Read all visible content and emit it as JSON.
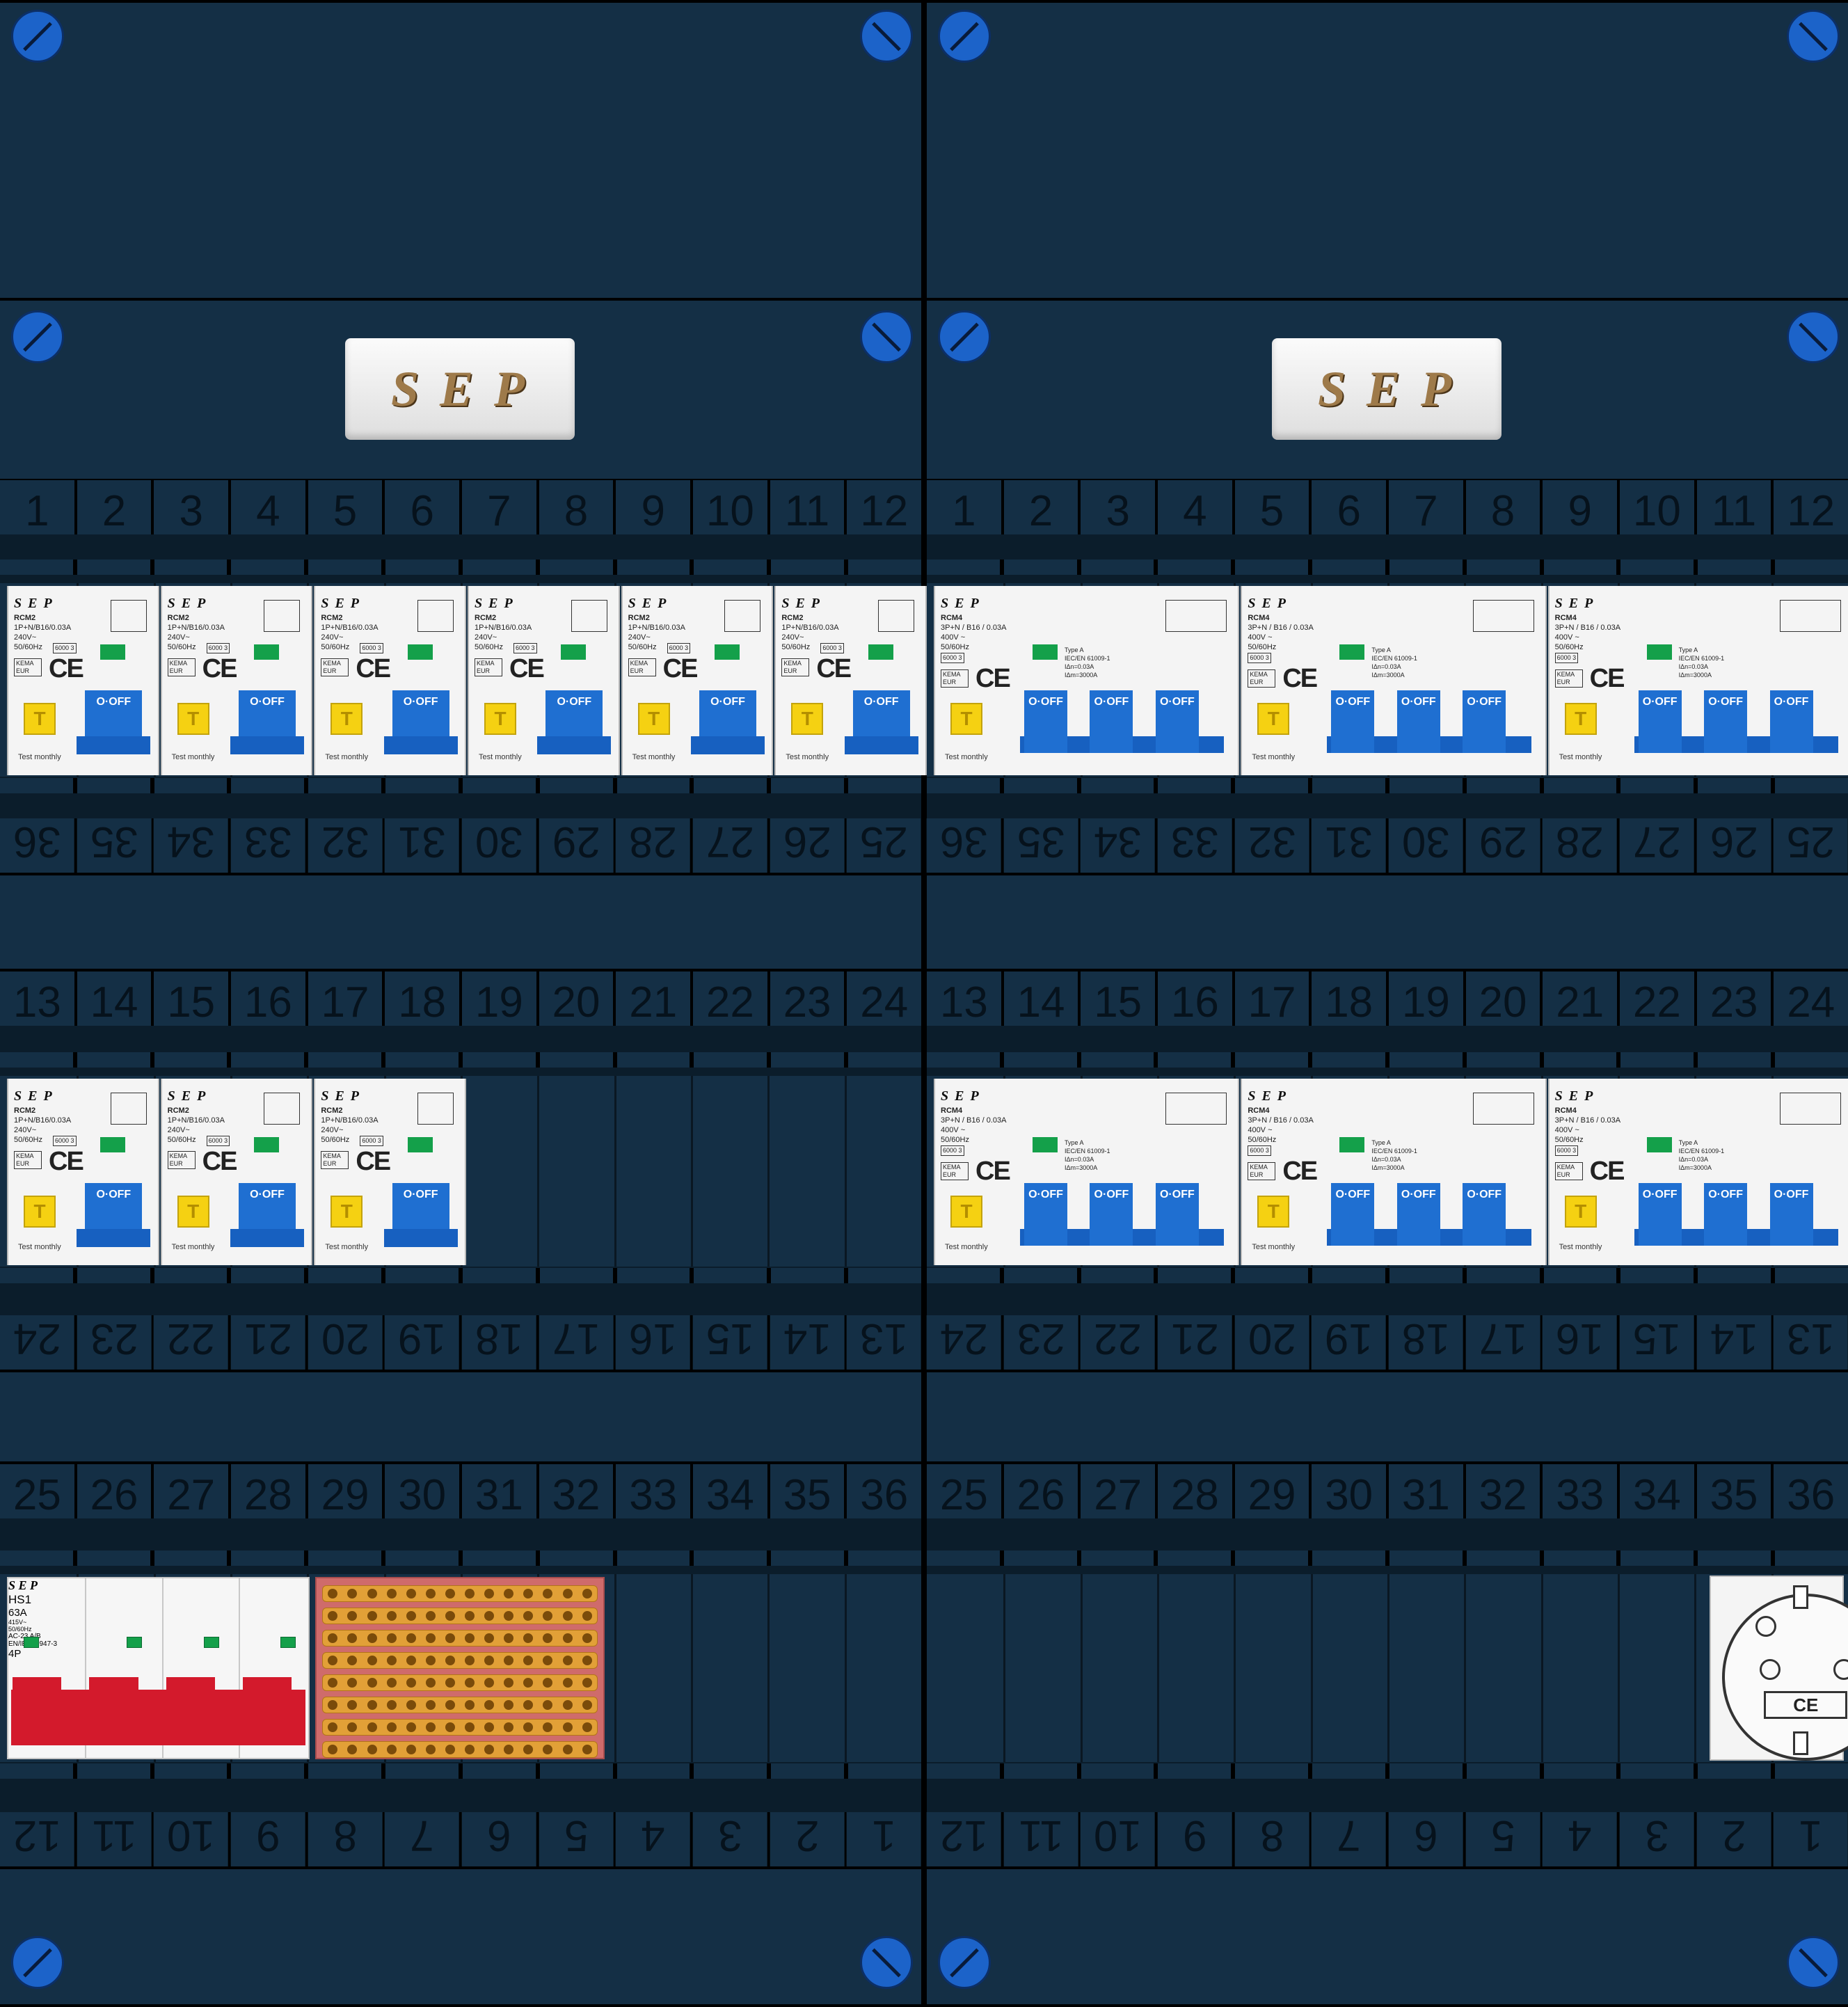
{
  "panels": [
    {
      "logo": "S E P",
      "rows": [
        {
          "top_numbers": [
            "1",
            "2",
            "3",
            "4",
            "5",
            "6",
            "7",
            "8",
            "9",
            "10",
            "11",
            "12"
          ],
          "bottom_numbers": [
            "36",
            "35",
            "34",
            "33",
            "32",
            "31",
            "30",
            "29",
            "28",
            "27",
            "26",
            "25"
          ],
          "devices": [
            {
              "model": "RCM2",
              "rating": "1P+N/B16/0.03A",
              "volt": "240V~",
              "freq": "50/60Hz",
              "code": "6000 3"
            },
            {
              "model": "RCM2",
              "rating": "1P+N/B16/0.03A",
              "volt": "240V~",
              "freq": "50/60Hz",
              "code": "6000 3"
            },
            {
              "model": "RCM2",
              "rating": "1P+N/B16/0.03A",
              "volt": "240V~",
              "freq": "50/60Hz",
              "code": "6000 3"
            },
            {
              "model": "RCM2",
              "rating": "1P+N/B16/0.03A",
              "volt": "240V~",
              "freq": "50/60Hz",
              "code": "6000 3"
            },
            {
              "model": "RCM2",
              "rating": "1P+N/B16/0.03A",
              "volt": "240V~",
              "freq": "50/60Hz",
              "code": "6000 3"
            },
            {
              "model": "RCM2",
              "rating": "1P+N/B16/0.03A",
              "volt": "240V~",
              "freq": "50/60Hz",
              "code": "6000 3"
            }
          ]
        },
        {
          "top_numbers": [
            "13",
            "14",
            "15",
            "16",
            "17",
            "18",
            "19",
            "20",
            "21",
            "22",
            "23",
            "24"
          ],
          "bottom_numbers": [
            "24",
            "23",
            "22",
            "21",
            "20",
            "19",
            "18",
            "17",
            "16",
            "15",
            "14",
            "13"
          ],
          "devices": [
            {
              "model": "RCM2",
              "rating": "1P+N/B16/0.03A",
              "volt": "240V~",
              "freq": "50/60Hz",
              "code": "6000 3"
            },
            {
              "model": "RCM2",
              "rating": "1P+N/B16/0.03A",
              "volt": "240V~",
              "freq": "50/60Hz",
              "code": "6000 3"
            },
            {
              "model": "RCM2",
              "rating": "1P+N/B16/0.03A",
              "volt": "240V~",
              "freq": "50/60Hz",
              "code": "6000 3"
            }
          ]
        },
        {
          "top_numbers": [
            "25",
            "26",
            "27",
            "28",
            "29",
            "30",
            "31",
            "32",
            "33",
            "34",
            "35",
            "36"
          ],
          "bottom_numbers": [
            "12",
            "11",
            "10",
            "9",
            "8",
            "7",
            "6",
            "5",
            "4",
            "3",
            "2",
            "1"
          ]
        }
      ],
      "main_switch": {
        "brand": "S E P",
        "name": "HS1",
        "rating": "63A",
        "volt": "415V~",
        "freq": "50/60Hz",
        "type": "AC-23 A/B",
        "standard": "EN/IEC60947-3",
        "poles": "4P"
      }
    },
    {
      "logo": "S E P",
      "rows": [
        {
          "top_numbers": [
            "1",
            "2",
            "3",
            "4",
            "5",
            "6",
            "7",
            "8",
            "9",
            "10",
            "11",
            "12"
          ],
          "bottom_numbers": [
            "36",
            "35",
            "34",
            "33",
            "32",
            "31",
            "30",
            "29",
            "28",
            "27",
            "26",
            "25"
          ],
          "devices": [
            {
              "model": "RCM4",
              "rating": "3P+N / B16 / 0.03A",
              "volt": "400V ~",
              "freq": "50/60Hz",
              "code": "6000 3",
              "typ": "Type A",
              "std": "IEC/EN 61009-1",
              "idn": "IΔn=0.03A",
              "idm": "IΔm=3000A"
            },
            {
              "model": "RCM4",
              "rating": "3P+N / B16 / 0.03A",
              "volt": "400V ~",
              "freq": "50/60Hz",
              "code": "6000 3",
              "typ": "Type A",
              "std": "IEC/EN 61009-1",
              "idn": "IΔn=0.03A",
              "idm": "IΔm=3000A"
            },
            {
              "model": "RCM4",
              "rating": "3P+N / B16 / 0.03A",
              "volt": "400V ~",
              "freq": "50/60Hz",
              "code": "6000 3",
              "typ": "Type A",
              "std": "IEC/EN 61009-1",
              "idn": "IΔn=0.03A",
              "idm": "IΔm=3000A"
            }
          ]
        },
        {
          "top_numbers": [
            "13",
            "14",
            "15",
            "16",
            "17",
            "18",
            "19",
            "20",
            "21",
            "22",
            "23",
            "24"
          ],
          "bottom_numbers": [
            "24",
            "23",
            "22",
            "21",
            "20",
            "19",
            "18",
            "17",
            "16",
            "15",
            "14",
            "13"
          ],
          "devices": [
            {
              "model": "RCM4",
              "rating": "3P+N / B16 / 0.03A",
              "volt": "400V ~",
              "freq": "50/60Hz",
              "code": "6000 3",
              "typ": "Type A",
              "std": "IEC/EN 61009-1",
              "idn": "IΔn=0.03A",
              "idm": "IΔm=3000A"
            },
            {
              "model": "RCM4",
              "rating": "3P+N / B16 / 0.03A",
              "volt": "400V ~",
              "freq": "50/60Hz",
              "code": "6000 3",
              "typ": "Type A",
              "std": "IEC/EN 61009-1",
              "idn": "IΔn=0.03A",
              "idm": "IΔm=3000A"
            },
            {
              "model": "RCM4",
              "rating": "3P+N / B16 / 0.03A",
              "volt": "400V ~",
              "freq": "50/60Hz",
              "code": "6000 3",
              "typ": "Type A",
              "std": "IEC/EN 61009-1",
              "idn": "IΔn=0.03A",
              "idm": "IΔm=3000A"
            }
          ]
        },
        {
          "top_numbers": [
            "25",
            "26",
            "27",
            "28",
            "29",
            "30",
            "31",
            "32",
            "33",
            "34",
            "35",
            "36"
          ],
          "bottom_numbers": [
            "12",
            "11",
            "10",
            "9",
            "8",
            "7",
            "6",
            "5",
            "4",
            "3",
            "2",
            "1"
          ]
        }
      ],
      "socket_mark": "CE"
    }
  ],
  "labels": {
    "test_button": "T",
    "off_label": "O·OFF",
    "test_text": "Test  monthly",
    "kema": "KEMA EUR",
    "ce": "CE"
  },
  "colors": {
    "cover": "#142f45",
    "lever": "#1f6fd1",
    "test_button": "#f5d112",
    "main_switch_red": "#d31a2c",
    "screw": "#1c63c9"
  }
}
